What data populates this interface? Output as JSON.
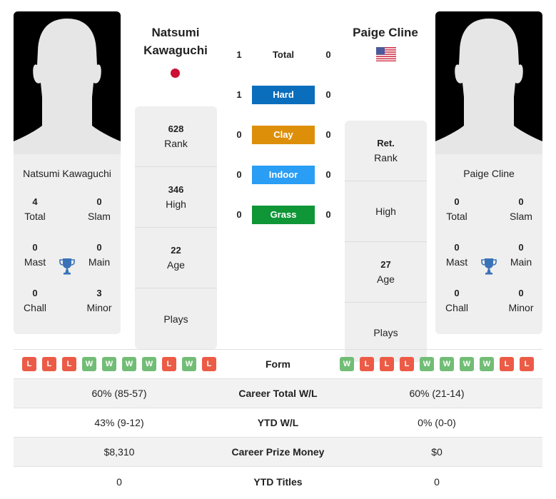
{
  "player1": {
    "name": "Natsumi Kawaguchi",
    "name_line1": "Natsumi",
    "name_line2": "Kawaguchi",
    "country_flag": "japan-flag",
    "card_name": "Natsumi Kawaguchi",
    "titles": {
      "total": {
        "value": "4",
        "label": "Total"
      },
      "slam": {
        "value": "0",
        "label": "Slam"
      },
      "mast": {
        "value": "0",
        "label": "Mast"
      },
      "main": {
        "value": "0",
        "label": "Main"
      },
      "chall": {
        "value": "0",
        "label": "Chall"
      },
      "minor": {
        "value": "3",
        "label": "Minor"
      }
    },
    "info": {
      "rank": {
        "value": "628",
        "label": "Rank"
      },
      "high": {
        "value": "346",
        "label": "High"
      },
      "age": {
        "value": "22",
        "label": "Age"
      },
      "plays": {
        "value": "",
        "label": "Plays"
      }
    },
    "form": [
      "L",
      "L",
      "L",
      "W",
      "W",
      "W",
      "W",
      "L",
      "W",
      "L"
    ],
    "career_total_wl": "60% (85-57)",
    "ytd_wl": "43% (9-12)",
    "career_prize_money": "$8,310",
    "ytd_titles": "0"
  },
  "player2": {
    "name": "Paige Cline",
    "country_flag": "usa-flag",
    "card_name": "Paige Cline",
    "titles": {
      "total": {
        "value": "0",
        "label": "Total"
      },
      "slam": {
        "value": "0",
        "label": "Slam"
      },
      "mast": {
        "value": "0",
        "label": "Mast"
      },
      "main": {
        "value": "0",
        "label": "Main"
      },
      "chall": {
        "value": "0",
        "label": "Chall"
      },
      "minor": {
        "value": "0",
        "label": "Minor"
      }
    },
    "info": {
      "rank": {
        "value": "Ret.",
        "label": "Rank"
      },
      "high": {
        "value": "",
        "label": "High"
      },
      "age": {
        "value": "27",
        "label": "Age"
      },
      "plays": {
        "value": "",
        "label": "Plays"
      }
    },
    "form": [
      "W",
      "L",
      "L",
      "L",
      "W",
      "W",
      "W",
      "W",
      "L",
      "L"
    ],
    "career_total_wl": "60% (21-14)",
    "ytd_wl": "0% (0-0)",
    "career_prize_money": "$0",
    "ytd_titles": "0"
  },
  "h2h": [
    {
      "label": "Total",
      "p1": "1",
      "p2": "0",
      "color": ""
    },
    {
      "label": "Hard",
      "p1": "1",
      "p2": "0",
      "color": "#0a6ebd"
    },
    {
      "label": "Clay",
      "p1": "0",
      "p2": "0",
      "color": "#de8f0a"
    },
    {
      "label": "Indoor",
      "p1": "0",
      "p2": "0",
      "color": "#2a9df4"
    },
    {
      "label": "Grass",
      "p1": "0",
      "p2": "0",
      "color": "#0f9637"
    }
  ],
  "table_labels": {
    "form": "Form",
    "career_total_wl": "Career Total W/L",
    "ytd_wl": "YTD W/L",
    "career_prize_money": "Career Prize Money",
    "ytd_titles": "YTD Titles"
  },
  "colors": {
    "win": "#72bd76",
    "loss": "#ec5b46",
    "trophy": "#3a72b8"
  }
}
